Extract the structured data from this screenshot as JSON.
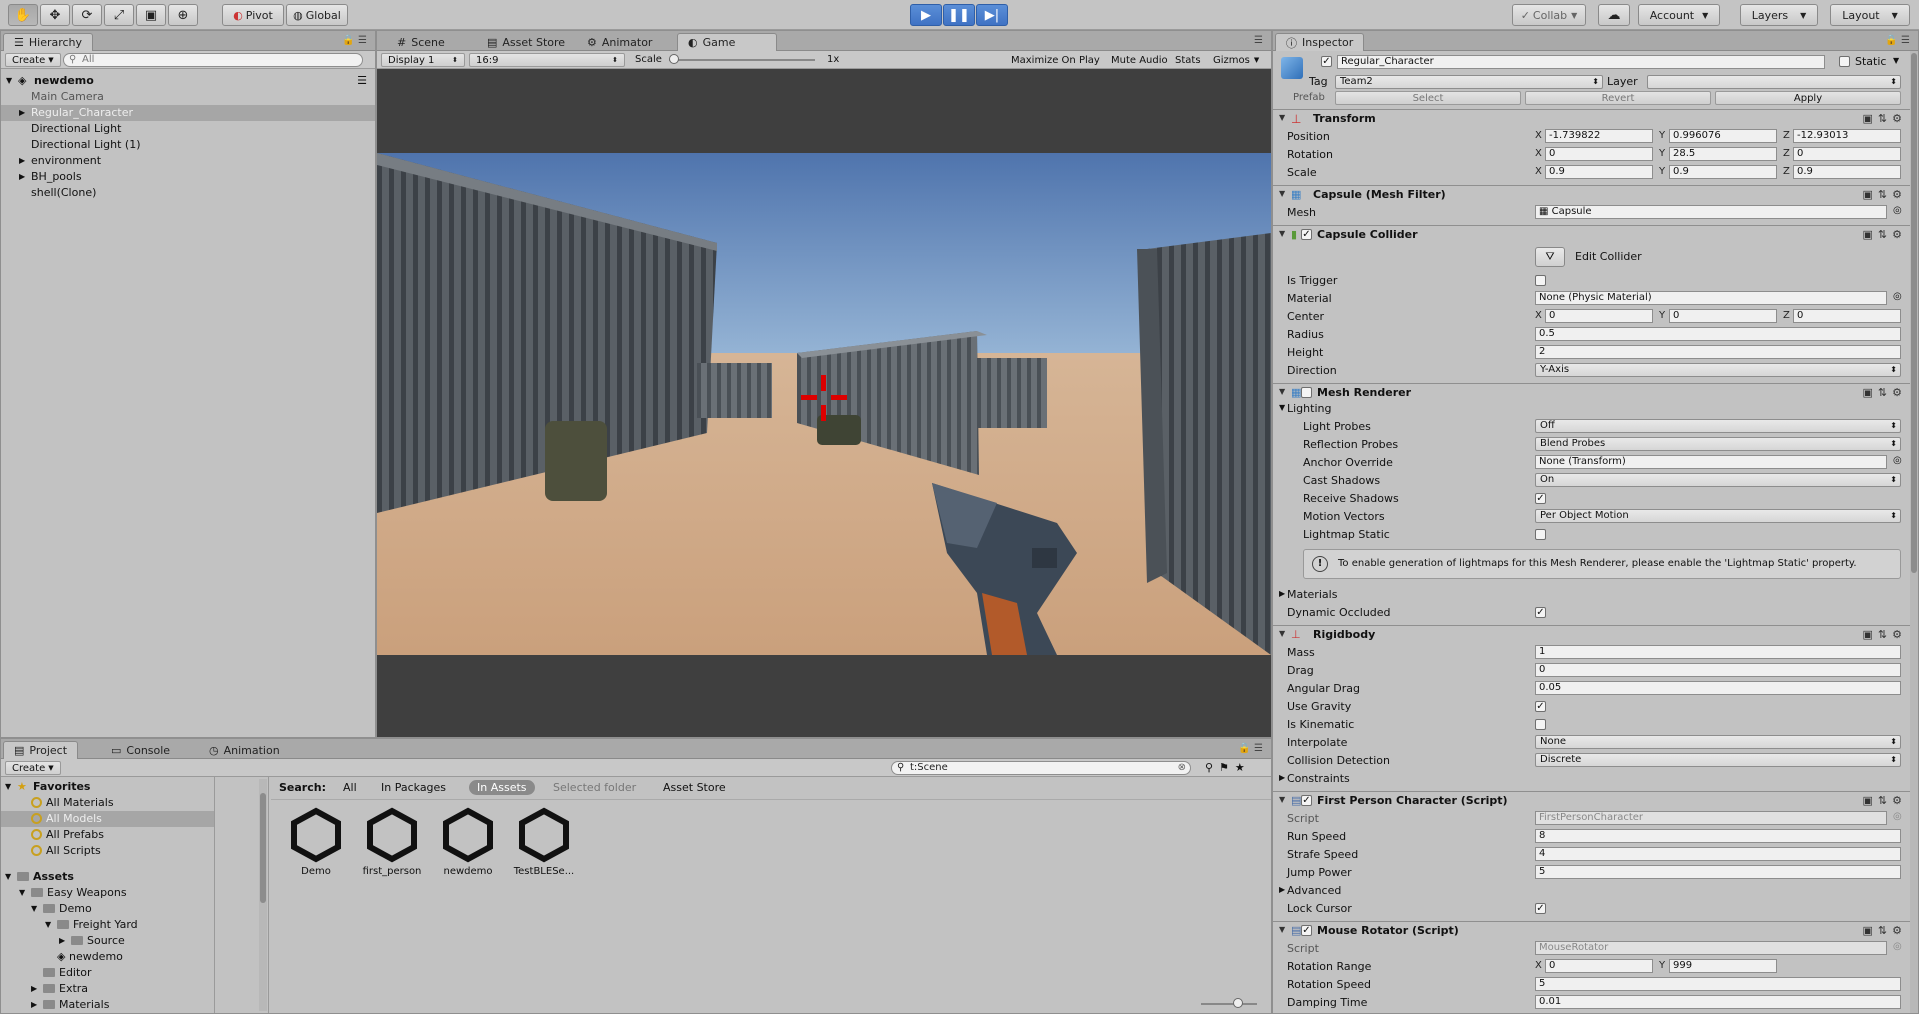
{
  "toolbar": {
    "pivot_label": "Pivot",
    "global_label": "Global",
    "collab_label": "Collab",
    "account_label": "Account",
    "layers_label": "Layers",
    "layout_label": "Layout"
  },
  "hierarchy": {
    "tab_label": "Hierarchy",
    "create_label": "Create",
    "search_placeholder": "All",
    "scene_name": "newdemo",
    "items": [
      {
        "label": "Main Camera"
      },
      {
        "label": "Regular_Character"
      },
      {
        "label": "Directional Light"
      },
      {
        "label": "Directional Light (1)"
      },
      {
        "label": "environment"
      },
      {
        "label": "BH_pools"
      },
      {
        "label": "shell(Clone)"
      }
    ]
  },
  "center": {
    "tabs": [
      {
        "label": "Scene"
      },
      {
        "label": "Asset Store"
      },
      {
        "label": "Animator"
      },
      {
        "label": "Game"
      }
    ],
    "display": "Display 1",
    "aspect": "16:9",
    "scale_label": "Scale",
    "scale_value": "1x",
    "maximize_label": "Maximize On Play",
    "mute_label": "Mute Audio",
    "stats_label": "Stats",
    "gizmos_label": "Gizmos"
  },
  "inspector": {
    "tab_label": "Inspector",
    "object_name": "Regular_Character",
    "static_label": "Static",
    "tag_label": "Tag",
    "tag_value": "Team2",
    "layer_label": "Layer",
    "prefab_label": "Prefab",
    "select_label": "Select",
    "revert_label": "Revert",
    "apply_label": "Apply",
    "transform": {
      "title": "Transform",
      "position_label": "Position",
      "rotation_label": "Rotation",
      "scale_label": "Scale",
      "position": [
        "-1.739822",
        "0.996076",
        "-12.93013"
      ],
      "rotation": [
        "0",
        "28.5",
        "0"
      ],
      "scale": [
        "0.9",
        "0.9",
        "0.9"
      ]
    },
    "mesh_filter": {
      "title": "Capsule (Mesh Filter)",
      "mesh_label": "Mesh",
      "mesh_value": "Capsule"
    },
    "capsule": {
      "title": "Capsule Collider",
      "edit_label": "Edit Collider",
      "is_trigger_label": "Is Trigger",
      "material_label": "Material",
      "material_value": "None (Physic Material)",
      "center_label": "Center",
      "center": [
        "0",
        "0",
        "0"
      ],
      "radius_label": "Radius",
      "radius": "0.5",
      "height_label": "Height",
      "height": "2",
      "direction_label": "Direction",
      "direction": "Y-Axis"
    },
    "mesh_renderer": {
      "title": "Mesh Renderer",
      "lighting_label": "Lighting",
      "light_probes_label": "Light Probes",
      "light_probes": "Off",
      "reflection_label": "Reflection Probes",
      "reflection": "Blend Probes",
      "anchor_label": "Anchor Override",
      "anchor": "None (Transform)",
      "cast_label": "Cast Shadows",
      "cast": "On",
      "receive_label": "Receive Shadows",
      "motion_label": "Motion Vectors",
      "motion": "Per Object Motion",
      "lightmap_label": "Lightmap Static",
      "info": "To enable generation of lightmaps for this Mesh Renderer, please enable the 'Lightmap Static' property.",
      "materials_label": "Materials",
      "occluded_label": "Dynamic Occluded"
    },
    "rigidbody": {
      "title": "Rigidbody",
      "mass_label": "Mass",
      "mass": "1",
      "drag_label": "Drag",
      "drag": "0",
      "angular_label": "Angular Drag",
      "angular": "0.05",
      "gravity_label": "Use Gravity",
      "kinematic_label": "Is Kinematic",
      "interpolate_label": "Interpolate",
      "interpolate": "None",
      "collision_label": "Collision Detection",
      "collision": "Discrete",
      "constraints_label": "Constraints"
    },
    "fpc": {
      "title": "First Person Character (Script)",
      "script_label": "Script",
      "script": "FirstPersonCharacter",
      "run_label": "Run Speed",
      "run": "8",
      "strafe_label": "Strafe Speed",
      "strafe": "4",
      "jump_label": "Jump Power",
      "jump": "5",
      "advanced_label": "Advanced",
      "lock_label": "Lock Cursor"
    },
    "mouse": {
      "title": "Mouse Rotator (Script)",
      "script_label": "Script",
      "script": "MouseRotator",
      "range_label": "Rotation Range",
      "range_x": "0",
      "range_y": "999",
      "speed_label": "Rotation Speed",
      "speed": "5",
      "damping_label": "Damping Time",
      "damping": "0.01"
    }
  },
  "project": {
    "tabs": [
      {
        "label": "Project"
      },
      {
        "label": "Console"
      },
      {
        "label": "Animation"
      }
    ],
    "create_label": "Create",
    "search_value": "t:Scene",
    "favorites_label": "Favorites",
    "favorites": [
      {
        "label": "All Materials"
      },
      {
        "label": "All Models"
      },
      {
        "label": "All Prefabs"
      },
      {
        "label": "All Scripts"
      }
    ],
    "assets_label": "Assets",
    "tree": [
      {
        "label": "Easy Weapons"
      },
      {
        "label": "Demo"
      },
      {
        "label": "Freight Yard"
      },
      {
        "label": "Source"
      },
      {
        "label": "newdemo"
      },
      {
        "label": "Editor"
      },
      {
        "label": "Extra"
      },
      {
        "label": "Materials"
      }
    ],
    "search_label": "Search:",
    "filters": [
      {
        "label": "All"
      },
      {
        "label": "In Packages"
      },
      {
        "label": "In Assets"
      },
      {
        "label": "Selected folder"
      },
      {
        "label": "Asset Store"
      }
    ],
    "assets": [
      {
        "label": "Demo"
      },
      {
        "label": "first_person"
      },
      {
        "label": "newdemo"
      },
      {
        "label": "TestBLESe..."
      }
    ]
  }
}
